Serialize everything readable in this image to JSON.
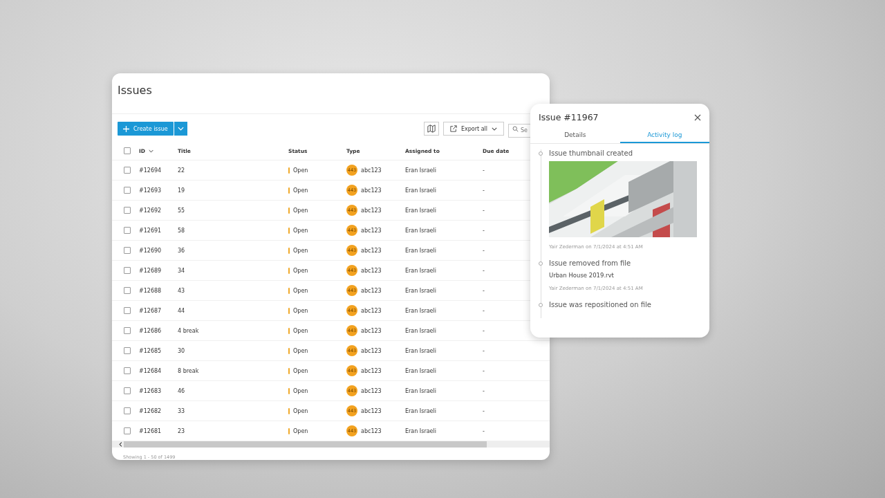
{
  "issues": {
    "title": "Issues",
    "toolbar": {
      "create_label": "Create issue",
      "export_label": "Export all",
      "search": {
        "placeholder": "Se"
      }
    },
    "table": {
      "select_all": {
        "checked": false
      },
      "columns": [
        "ID",
        "Title",
        "Status",
        "Type",
        "Assigned to",
        "Due date"
      ],
      "rows": [
        {
          "id": "#12694",
          "title": "22",
          "status": "Open",
          "badge": "443",
          "type": "abc123",
          "assigned": "Eran Israeli",
          "due": "-",
          "checked": false
        },
        {
          "id": "#12693",
          "title": "19",
          "status": "Open",
          "badge": "443",
          "type": "abc123",
          "assigned": "Eran Israeli",
          "due": "-",
          "checked": false
        },
        {
          "id": "#12692",
          "title": "55",
          "status": "Open",
          "badge": "443",
          "type": "abc123",
          "assigned": "Eran Israeli",
          "due": "-",
          "checked": false
        },
        {
          "id": "#12691",
          "title": "58",
          "status": "Open",
          "badge": "443",
          "type": "abc123",
          "assigned": "Eran Israeli",
          "due": "-",
          "checked": false
        },
        {
          "id": "#12690",
          "title": "36",
          "status": "Open",
          "badge": "443",
          "type": "abc123",
          "assigned": "Eran Israeli",
          "due": "-",
          "checked": false
        },
        {
          "id": "#12689",
          "title": "34",
          "status": "Open",
          "badge": "443",
          "type": "abc123",
          "assigned": "Eran Israeli",
          "due": "-",
          "checked": false
        },
        {
          "id": "#12688",
          "title": "43",
          "status": "Open",
          "badge": "443",
          "type": "abc123",
          "assigned": "Eran Israeli",
          "due": "-",
          "checked": false
        },
        {
          "id": "#12687",
          "title": "44",
          "status": "Open",
          "badge": "443",
          "type": "abc123",
          "assigned": "Eran Israeli",
          "due": "-",
          "checked": false
        },
        {
          "id": "#12686",
          "title": "4 break",
          "status": "Open",
          "badge": "443",
          "type": "abc123",
          "assigned": "Eran Israeli",
          "due": "-",
          "checked": false
        },
        {
          "id": "#12685",
          "title": "30",
          "status": "Open",
          "badge": "443",
          "type": "abc123",
          "assigned": "Eran Israeli",
          "due": "-",
          "checked": false
        },
        {
          "id": "#12684",
          "title": "8 break",
          "status": "Open",
          "badge": "443",
          "type": "abc123",
          "assigned": "Eran Israeli",
          "due": "-",
          "checked": false
        },
        {
          "id": "#12683",
          "title": "46",
          "status": "Open",
          "badge": "443",
          "type": "abc123",
          "assigned": "Eran Israeli",
          "due": "-",
          "checked": false
        },
        {
          "id": "#12682",
          "title": "33",
          "status": "Open",
          "badge": "443",
          "type": "abc123",
          "assigned": "Eran Israeli",
          "due": "-",
          "checked": false
        },
        {
          "id": "#12681",
          "title": "23",
          "status": "Open",
          "badge": "443",
          "type": "abc123",
          "assigned": "Eran Israeli",
          "due": "-",
          "checked": false
        }
      ]
    },
    "footer": "Showing 1 - 50 of 1499"
  },
  "panel": {
    "title": "Issue #11967",
    "tabs": [
      {
        "label": "Details",
        "selected": false
      },
      {
        "label": "Activity log",
        "selected": true
      }
    ],
    "activity": [
      {
        "title": "Issue thumbnail created",
        "meta": "Yair Zederman on 7/1/2024 at 4:51 AM"
      },
      {
        "title": "Issue removed from file",
        "file": "Urban House 2019.rvt",
        "meta": "Yair Zederman on 7/1/2024 at 4:51 AM"
      },
      {
        "title": "Issue was repositioned on file"
      }
    ]
  }
}
